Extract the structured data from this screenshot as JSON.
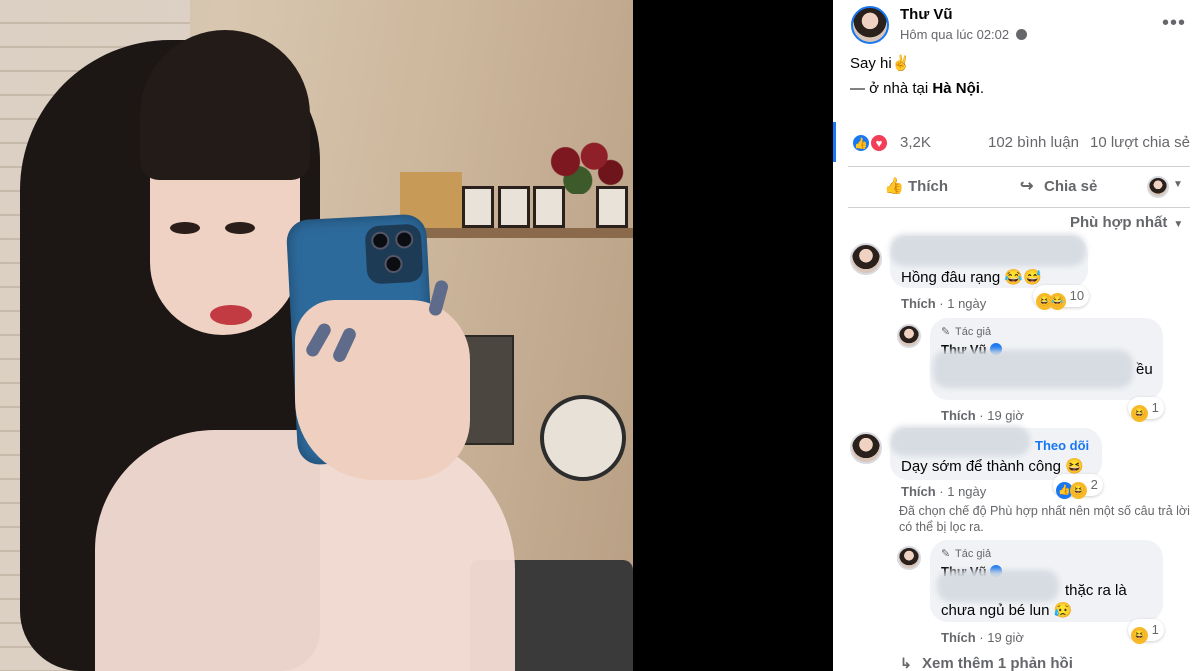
{
  "post": {
    "author": "Thư Vũ",
    "time": "Hôm qua lúc 02:02",
    "text": "Say hi✌️",
    "location_prefix": "— ở nhà tại ",
    "location": "Hà Nội",
    "location_suffix": ".",
    "reactions": "3,2K",
    "comments": "102 bình luận",
    "shares": "10 lượt chia sẻ"
  },
  "actions": {
    "like": "Thích",
    "share": "Chia sẻ"
  },
  "sort": {
    "label": "Phù hợp nhất"
  },
  "comments": [
    {
      "text": "Hồng đâu rạng 😂😅",
      "like": "Thích",
      "time": "1 ngày",
      "reaction_count": "10",
      "reply": {
        "badge": "Tác giả",
        "name": "Thư Vũ",
        "text": "ều",
        "like": "Thích",
        "time": "19 giờ",
        "reaction_count": "1"
      }
    },
    {
      "follow": "Theo dõi",
      "text": "Dạy sớm để thành công 😆",
      "like": "Thích",
      "time": "1 ngày",
      "reaction_count": "2",
      "notice": "Đã chọn chế độ Phù hợp nhất nên một số câu trả lời có thể bị lọc ra.",
      "reply": {
        "badge": "Tác giả",
        "name": "Thư Vũ",
        "text_line1": "thặc ra là",
        "text_line2": "chưa ngủ bé lun 😥",
        "like": "Thích",
        "time": "19 giờ",
        "reaction_count": "1"
      }
    }
  ],
  "see_more": "Xem thêm 1 phản hồi",
  "icons": [
    "more-icon",
    "globe-icon",
    "like-icon",
    "love-icon",
    "thumb-icon",
    "share-arrow-icon",
    "caret-down-icon",
    "verified-icon",
    "pen-icon",
    "haha-icon",
    "reply-arrow-icon"
  ],
  "colors": {
    "accent": "#1877f2",
    "text_secondary": "#65676b",
    "bubble": "#f0f2f5",
    "love": "#f33e58"
  }
}
